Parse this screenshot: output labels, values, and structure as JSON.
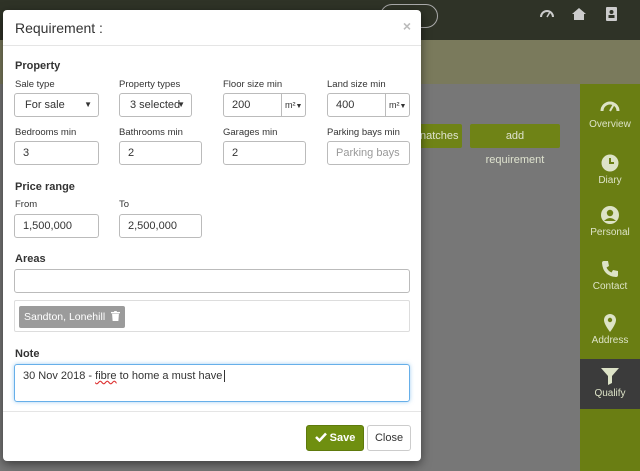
{
  "background": {
    "nav": [
      {
        "label": "Overview",
        "icon": "dashboard-icon"
      },
      {
        "label": "Diary",
        "icon": "clock-icon"
      },
      {
        "label": "Personal",
        "icon": "user-icon"
      },
      {
        "label": "Contact",
        "icon": "phone-icon"
      },
      {
        "label": "Address",
        "icon": "map-marker-icon"
      },
      {
        "label": "Qualify",
        "icon": "filter-icon"
      }
    ],
    "matches_label": "natches",
    "add_requirement_label": "add requirement"
  },
  "modal": {
    "title": "Requirement :",
    "close_glyph": "×",
    "property": {
      "heading": "Property",
      "sale_type": {
        "label": "Sale type",
        "value": "For sale"
      },
      "property_types": {
        "label": "Property types",
        "value": "3 selected"
      },
      "floor_size_min": {
        "label": "Floor size min",
        "value": "200",
        "unit": "m²"
      },
      "land_size_min": {
        "label": "Land size min",
        "value": "400",
        "unit": "m²"
      },
      "bedrooms_min": {
        "label": "Bedrooms min",
        "value": "3"
      },
      "bathrooms_min": {
        "label": "Bathrooms min",
        "value": "2"
      },
      "garages_min": {
        "label": "Garages min",
        "value": "2"
      },
      "parking_bays_min": {
        "label": "Parking bays min",
        "placeholder": "Parking bays"
      }
    },
    "price_range": {
      "heading": "Price range",
      "from": {
        "label": "From",
        "value": "1,500,000"
      },
      "to": {
        "label": "To",
        "value": "2,500,000"
      }
    },
    "areas": {
      "heading": "Areas",
      "input_value": "",
      "tags": [
        "Sandton, Lonehill"
      ]
    },
    "note": {
      "heading": "Note",
      "value_before": "30 Nov 2018 - ",
      "value_misspelled": "fibre",
      "value_after": " to home a must have"
    },
    "footer": {
      "save_label": "Save",
      "close_label": "Close"
    }
  },
  "colors": {
    "accent": "#6f8f10",
    "nav_bg": "#6a7e13",
    "nav_active_bg": "#3b3b3b",
    "focus_border": "#66afe9"
  }
}
